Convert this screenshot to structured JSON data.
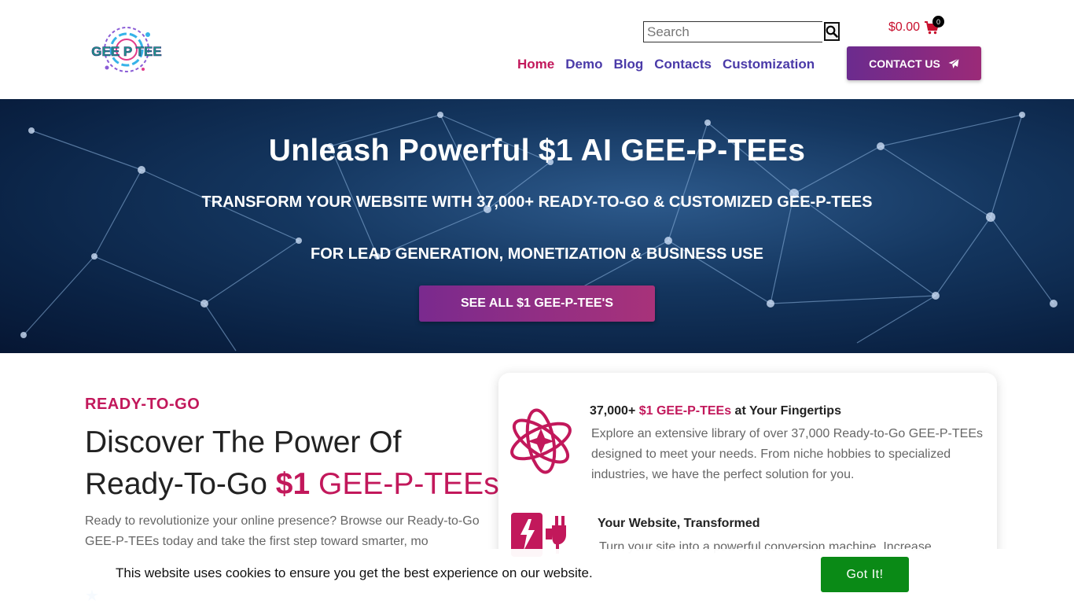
{
  "header": {
    "logo_text": "GEE P TEE",
    "search": {
      "placeholder": "Search"
    },
    "cart": {
      "amount": "$0.00",
      "count": "0"
    },
    "nav": [
      {
        "label": "Home",
        "active": true
      },
      {
        "label": "Demo"
      },
      {
        "label": "Blog"
      },
      {
        "label": "Contacts"
      },
      {
        "label": "Customization"
      }
    ],
    "contact_button": "CONTACT US"
  },
  "hero": {
    "title": "Unleash Powerful $1 AI GEE-P-TEEs",
    "subtitle_line1": "TRANSFORM YOUR WEBSITE WITH 37,000+ READY-TO-GO & CUSTOMIZED GEE-P-TEES",
    "subtitle_line2": "FOR LEAD GENERATION, MONETIZATION & BUSINESS USE",
    "cta": "SEE ALL $1 GEE-P-TEE'S"
  },
  "section": {
    "eyebrow": "READY-TO-GO",
    "title_part1": "Discover The Power Of Ready-To-Go ",
    "title_accent_bold": "$1",
    "title_accent": " GEE-P-TEEs",
    "intro": "Ready to revolutionize your online presence? Browse our Ready-to-Go GEE-P-TEEs today and take the first step toward smarter, mo"
  },
  "features": [
    {
      "title_prefix": "37,000+ ",
      "title_highlight": "$1 GEE-P-TEEs",
      "title_suffix": " at Your Fingertips",
      "text": "Explore an extensive library of over 37,000 Ready-to-Go GEE-P-TEEs designed to meet your needs. From niche hobbies to specialized industries, we have the perfect solution for you."
    },
    {
      "title": "Your Website, Transformed",
      "text": "Turn your site into a powerful conversion machine. Increase"
    }
  ],
  "cookie": {
    "text": "This website uses cookies to ensure you get the best experience on our website.",
    "button": "Got It!"
  },
  "colors": {
    "accent_pink": "#c2185b",
    "nav_purple": "#4a3aa8",
    "button_gradient_start": "#6b2b8e",
    "cookie_green": "#0a8a16"
  }
}
